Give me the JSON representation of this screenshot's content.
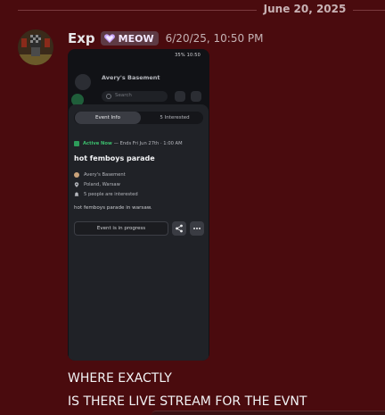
{
  "date_divider": {
    "label": "June 20, 2025"
  },
  "message": {
    "username": "Exp",
    "tag": {
      "label": "MEOW",
      "icon": "purple-heart-icon",
      "color": "#c9a6ff"
    },
    "timestamp": "6/20/25, 10:50 PM",
    "lines": [
      "WHERE EXACTLY",
      "IS THERE LIVE STREAM FOR THE EVNT"
    ]
  },
  "attachment": {
    "statusbar_text": "35% 10:50",
    "server_name": "Avery's Basement",
    "search_placeholder": "Search",
    "tabs": [
      {
        "label": "Event Info"
      },
      {
        "label": "5 Interested"
      }
    ],
    "active_label": "Active Now",
    "active_suffix": "— Ends Fri Jun 27th · 1:00 AM",
    "event_title": "hot femboys parade",
    "host": "Avery's Basement",
    "location": "Poland, Warsaw",
    "interested": "5 people are interested",
    "description": "hot femboys parade in warsaw.",
    "progress_button": "Event is in progress"
  },
  "colors": {
    "background": "#4a0b0e",
    "active_green": "#3cbf6e",
    "tag_bg": "#5e3a44"
  }
}
